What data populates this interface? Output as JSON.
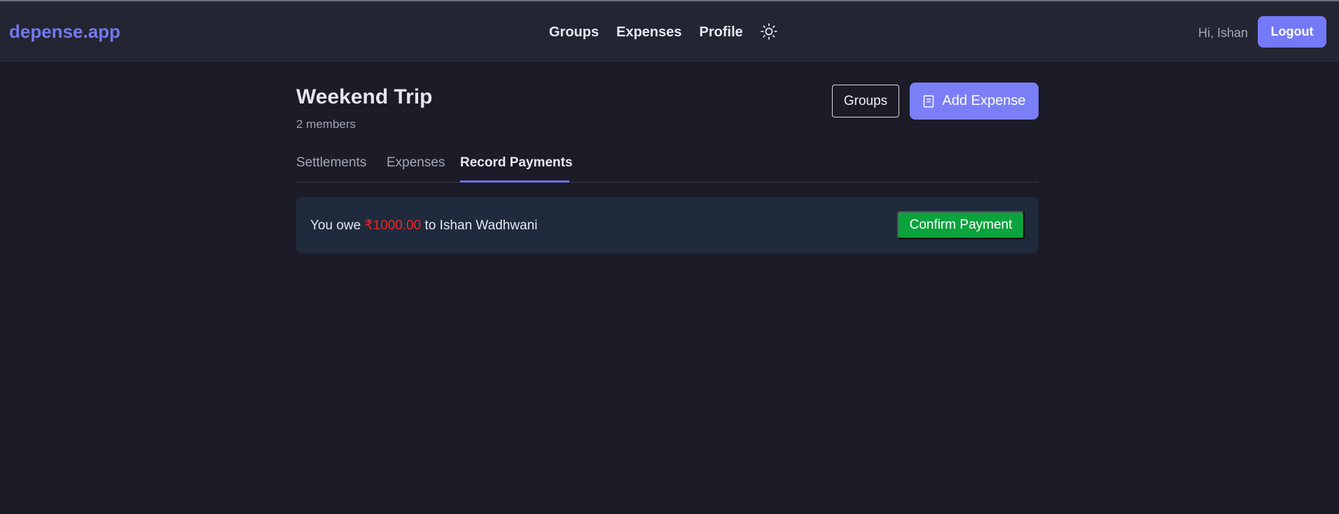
{
  "navbar": {
    "brand": "depense.app",
    "links": [
      {
        "label": "Groups"
      },
      {
        "label": "Expenses"
      },
      {
        "label": "Profile"
      }
    ],
    "theme_icon": "sun-icon",
    "greeting": "Hi, Ishan",
    "logout_label": "Logout"
  },
  "group": {
    "title": "Weekend Trip",
    "members_text": "2 members",
    "groups_button": "Groups",
    "add_expense_button": "Add Expense",
    "add_expense_icon": "document-icon"
  },
  "tabs": [
    {
      "label": "Settlements",
      "active": false
    },
    {
      "label": "Expenses",
      "active": false
    },
    {
      "label": "Record Payments",
      "active": true
    }
  ],
  "payment": {
    "prefix": "You owe",
    "amount": "₹1000.00",
    "suffix": "to Ishan Wadhwani",
    "confirm_label": "Confirm Payment"
  },
  "colors": {
    "background": "#1b1c27",
    "navbar": "#242532",
    "accent": "#7479f7",
    "amount": "#e82727",
    "confirm": "#0aa33c",
    "card": "#1f2a3c"
  }
}
